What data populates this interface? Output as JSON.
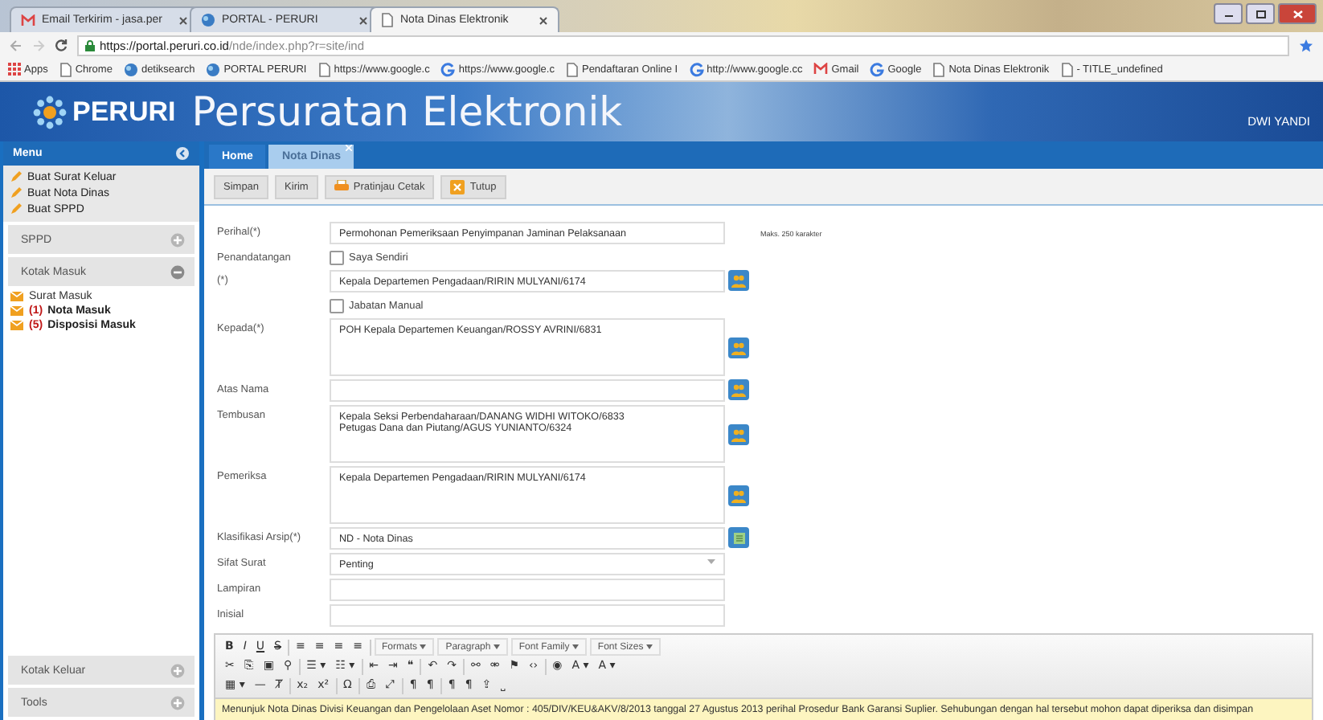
{
  "browser": {
    "tabs": [
      {
        "title": "Email Terkirim - jasa.per",
        "selected": false
      },
      {
        "title": "PORTAL - PERURI",
        "selected": false
      },
      {
        "title": "Nota Dinas Elektronik",
        "selected": true
      }
    ],
    "url_host": "https://portal.peruri.co.id",
    "url_path": "/nde/index.php?r=site/ind",
    "bookmarks": [
      "Apps",
      "Chrome",
      "detiksearch",
      "PORTAL PERURI",
      "https://www.google.c",
      "https://www.google.c",
      "Pendaftaran Online I",
      "http://www.google.cc",
      "Gmail",
      "Google",
      "Nota Dinas Elektronik",
      "- TITLE_undefined"
    ]
  },
  "header": {
    "brand": "PERURI",
    "title": "Persuratan Elektronik",
    "user": "DWI YANDI"
  },
  "sidebar": {
    "title": "Menu",
    "actions": [
      "Buat Surat Keluar",
      "Buat Nota Dinas",
      "Buat SPPD"
    ],
    "sections": [
      {
        "title": "SPPD",
        "expanded": false
      },
      {
        "title": "Kotak Masuk",
        "expanded": true,
        "items": [
          {
            "label": "Surat Masuk",
            "unread": false
          },
          {
            "count": "(1)",
            "label": "Nota Masuk",
            "unread": true
          },
          {
            "count": "(5)",
            "label": "Disposisi Masuk",
            "unread": true
          }
        ]
      }
    ],
    "bottom_sections": [
      {
        "title": "Kotak Keluar",
        "expanded": false
      },
      {
        "title": "Tools",
        "expanded": false
      }
    ]
  },
  "main_tabs": [
    {
      "label": "Home",
      "selected": false,
      "closable": false
    },
    {
      "label": "Nota Dinas",
      "selected": true,
      "closable": true
    }
  ],
  "toolbar": [
    {
      "label": "Simpan",
      "kind": "plain"
    },
    {
      "label": "Kirim",
      "kind": "plain"
    },
    {
      "label": "Pratinjau Cetak",
      "kind": "print"
    },
    {
      "label": "Tutup",
      "kind": "close"
    }
  ],
  "form": [
    {
      "kind": "text",
      "label": "Perihal(*)",
      "value": "Permohonan Pemeriksaan Penyimpanan Jaminan Pelaksanaan",
      "hint": "Maks. 250 karakter",
      "picker": false
    },
    {
      "kind": "checkbox",
      "label": "Penandatangan",
      "option": "Saya Sendiri",
      "checked": false
    },
    {
      "kind": "text",
      "label": "(*)",
      "value": "Kepala Departemen Pengadaan/RIRIN MULYANI/6174",
      "picker": true
    },
    {
      "kind": "checkbox",
      "option": "Jabatan Manual",
      "checked": false
    },
    {
      "kind": "textarea",
      "label": "Kepada(*)",
      "value": "POH Kepala Departemen Keuangan/ROSSY AVRINI/6831",
      "picker": true
    },
    {
      "kind": "text",
      "label": "Atas Nama",
      "picker": true
    },
    {
      "kind": "textarea",
      "label": "Tembusan",
      "value": "Kepala Seksi Perbendaharaan/DANANG WIDHI WITOKO/6833\nPetugas Dana dan Piutang/AGUS YUNIANTO/6324",
      "picker": true
    },
    {
      "kind": "textarea",
      "label": "Pemeriksa",
      "value": "Kepala Departemen Pengadaan/RIRIN MULYANI/6174",
      "picker": true
    },
    {
      "kind": "catalog",
      "label": "Klasifikasi Arsip(*)",
      "value": "ND - Nota Dinas",
      "picker": true
    },
    {
      "kind": "select",
      "label": "Sifat Surat",
      "value": "Penting",
      "picker": false
    },
    {
      "kind": "text",
      "label": "Lampiran",
      "picker": false
    },
    {
      "kind": "text",
      "label": "Inisial",
      "picker": false
    }
  ],
  "editor": {
    "toolbar_rows": [
      [
        {
          "kind": "bold",
          "label": "B"
        },
        {
          "kind": "italic",
          "label": "I"
        },
        {
          "kind": "underline",
          "label": "U"
        },
        {
          "kind": "strike",
          "label": "S"
        },
        {
          "kind": "sep"
        },
        {
          "kind": "glyph",
          "label": "≡"
        },
        {
          "kind": "glyph",
          "label": "≡"
        },
        {
          "kind": "glyph",
          "label": "≡"
        },
        {
          "kind": "glyph",
          "label": "≡"
        },
        {
          "kind": "sep"
        },
        {
          "kind": "dropdown",
          "label": "Formats"
        },
        {
          "kind": "dropdown",
          "label": "Paragraph"
        },
        {
          "kind": "dropdown",
          "label": "Font Family"
        },
        {
          "kind": "dropdown",
          "label": "Font Sizes"
        }
      ],
      [
        {
          "kind": "glyph",
          "label": "✂"
        },
        {
          "kind": "glyph",
          "label": "⎘"
        },
        {
          "kind": "glyph",
          "label": "▣"
        },
        {
          "kind": "glyph",
          "label": "⚲"
        },
        {
          "kind": "sep"
        },
        {
          "kind": "glyph",
          "label": "☰ ▾"
        },
        {
          "kind": "glyph",
          "label": "☷ ▾"
        },
        {
          "kind": "sep"
        },
        {
          "kind": "glyph",
          "label": "⇤"
        },
        {
          "kind": "glyph",
          "label": "⇥"
        },
        {
          "kind": "glyph",
          "label": "❝"
        },
        {
          "kind": "sep"
        },
        {
          "kind": "glyph",
          "label": "↶"
        },
        {
          "kind": "glyph",
          "label": "↷"
        },
        {
          "kind": "sep"
        },
        {
          "kind": "glyph",
          "label": "⚯"
        },
        {
          "kind": "glyph",
          "label": "⚮"
        },
        {
          "kind": "glyph",
          "label": "⚑"
        },
        {
          "kind": "glyph",
          "label": "‹›"
        },
        {
          "kind": "sep"
        },
        {
          "kind": "glyph",
          "label": "◉"
        },
        {
          "kind": "glyph",
          "label": "A ▾"
        },
        {
          "kind": "glyph",
          "label": "A ▾"
        }
      ],
      [
        {
          "kind": "glyph",
          "label": "▦ ▾"
        },
        {
          "kind": "glyph",
          "label": "—"
        },
        {
          "kind": "glyph",
          "label": "Ⱦ"
        },
        {
          "kind": "sep"
        },
        {
          "kind": "glyph",
          "label": "x₂"
        },
        {
          "kind": "glyph",
          "label": "x²"
        },
        {
          "kind": "sep"
        },
        {
          "kind": "glyph",
          "label": "Ω"
        },
        {
          "kind": "sep"
        },
        {
          "kind": "glyph",
          "label": "⎙"
        },
        {
          "kind": "glyph",
          "label": "⤢"
        },
        {
          "kind": "sep"
        },
        {
          "kind": "glyph",
          "label": "¶"
        },
        {
          "kind": "glyph",
          "label": "¶"
        },
        {
          "kind": "sep"
        },
        {
          "kind": "glyph",
          "label": "¶"
        },
        {
          "kind": "glyph",
          "label": "¶"
        },
        {
          "kind": "glyph",
          "label": "⇪"
        },
        {
          "kind": "glyph",
          "label": "⎵"
        }
      ]
    ],
    "content": "Menunjuk Nota Dinas Divisi Keuangan dan Pengelolaan Aset Nomor : 405/DIV/KEU&AKV/8/2013 tanggal 27 Agustus 2013 perihal Prosedur Bank Garansi Suplier. Sehubungan dengan hal tersebut mohon dapat diperiksa dan disimpan"
  }
}
